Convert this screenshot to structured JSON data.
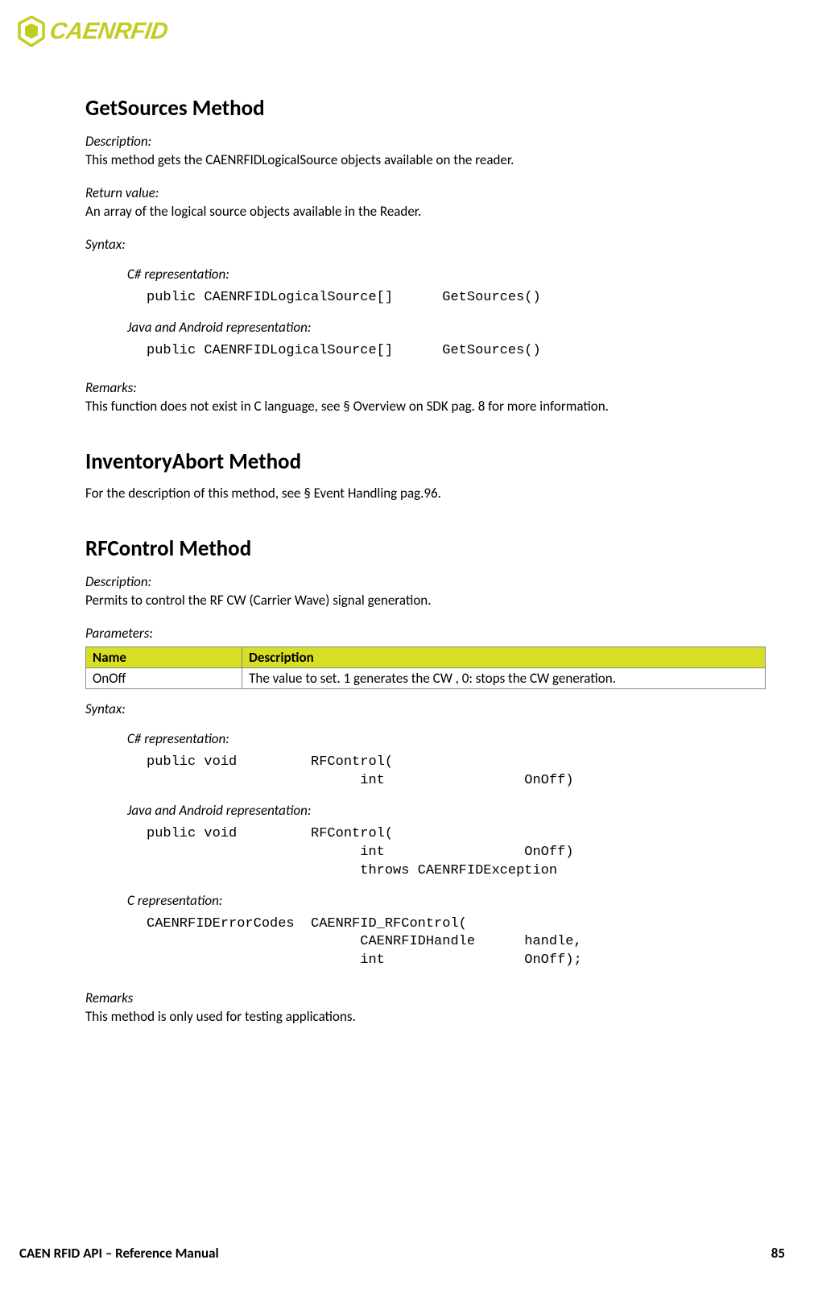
{
  "brand": {
    "text": "CAENRFID"
  },
  "sections": {
    "getSources": {
      "heading": "GetSources Method",
      "descLabel": "Description:",
      "descText": "This method gets the CAENRFIDLogicalSource objects available on the reader.",
      "returnLabel": "Return value:",
      "returnText": "An array of the logical source objects available in the Reader.",
      "syntaxLabel": "Syntax:",
      "csharpLabel": "C# representation:",
      "csharpCode": "public CAENRFIDLogicalSource[]      GetSources()",
      "javaLabel": "Java and Android representation:",
      "javaCode": "public CAENRFIDLogicalSource[]      GetSources()",
      "remarksLabel": "Remarks:",
      "remarksText": "This function does not exist in C language, see § Overview on SDK pag. 8 for more information."
    },
    "inventoryAbort": {
      "heading": "InventoryAbort Method",
      "text": "For the description of this method, see § Event Handling pag.96."
    },
    "rfControl": {
      "heading": "RFControl Method",
      "descLabel": "Description:",
      "descText": "Permits to control the RF CW (Carrier Wave) signal generation.",
      "paramsLabel": "Parameters:",
      "table": {
        "headName": "Name",
        "headDesc": "Description",
        "row1Name": "OnOff",
        "row1Desc": "The value to set. 1 generates the CW , 0: stops the CW generation."
      },
      "syntaxLabel": "Syntax:",
      "csharpLabel": "C# representation:",
      "csharpCode": "public void         RFControl(\n                          int                 OnOff)",
      "javaLabel": "Java and Android representation:",
      "javaCode": "public void         RFControl(\n                          int                 OnOff)\n                          throws CAENRFIDException",
      "cLabel": "C representation:",
      "cCode": "CAENRFIDErrorCodes  CAENRFID_RFControl(\n                          CAENRFIDHandle      handle,\n                          int                 OnOff);",
      "remarksLabel": "Remarks",
      "remarksText": "This method is only used for testing applications."
    }
  },
  "footer": {
    "left": "CAEN RFID API – Reference Manual",
    "right": "85"
  }
}
